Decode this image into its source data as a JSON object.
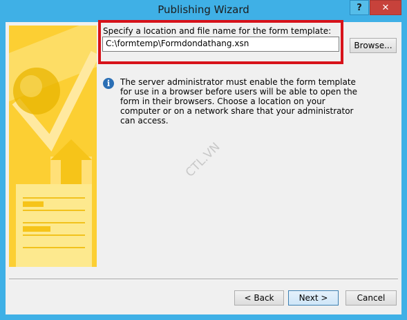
{
  "window": {
    "title": "Publishing Wizard",
    "help_label": "?",
    "close_label": "✕"
  },
  "location": {
    "label": "Specify a location and file name for the form template:",
    "value": "C:\\formtemp\\Formdondathang.xsn",
    "browse_label": "Browse..."
  },
  "info": {
    "icon": "info-icon",
    "text": "The server administrator must enable the form template for use in a browser before users will be able to open the form in their browsers. Choose a location on your computer or on a network share that your administrator can access."
  },
  "watermark": "CTL.VN",
  "buttons": {
    "back": "< Back",
    "next": "Next >",
    "cancel": "Cancel"
  },
  "colors": {
    "titlebar": "#3fb0e6",
    "close": "#c7423b",
    "highlight": "#d7121a",
    "banner": "#fcd63c"
  }
}
